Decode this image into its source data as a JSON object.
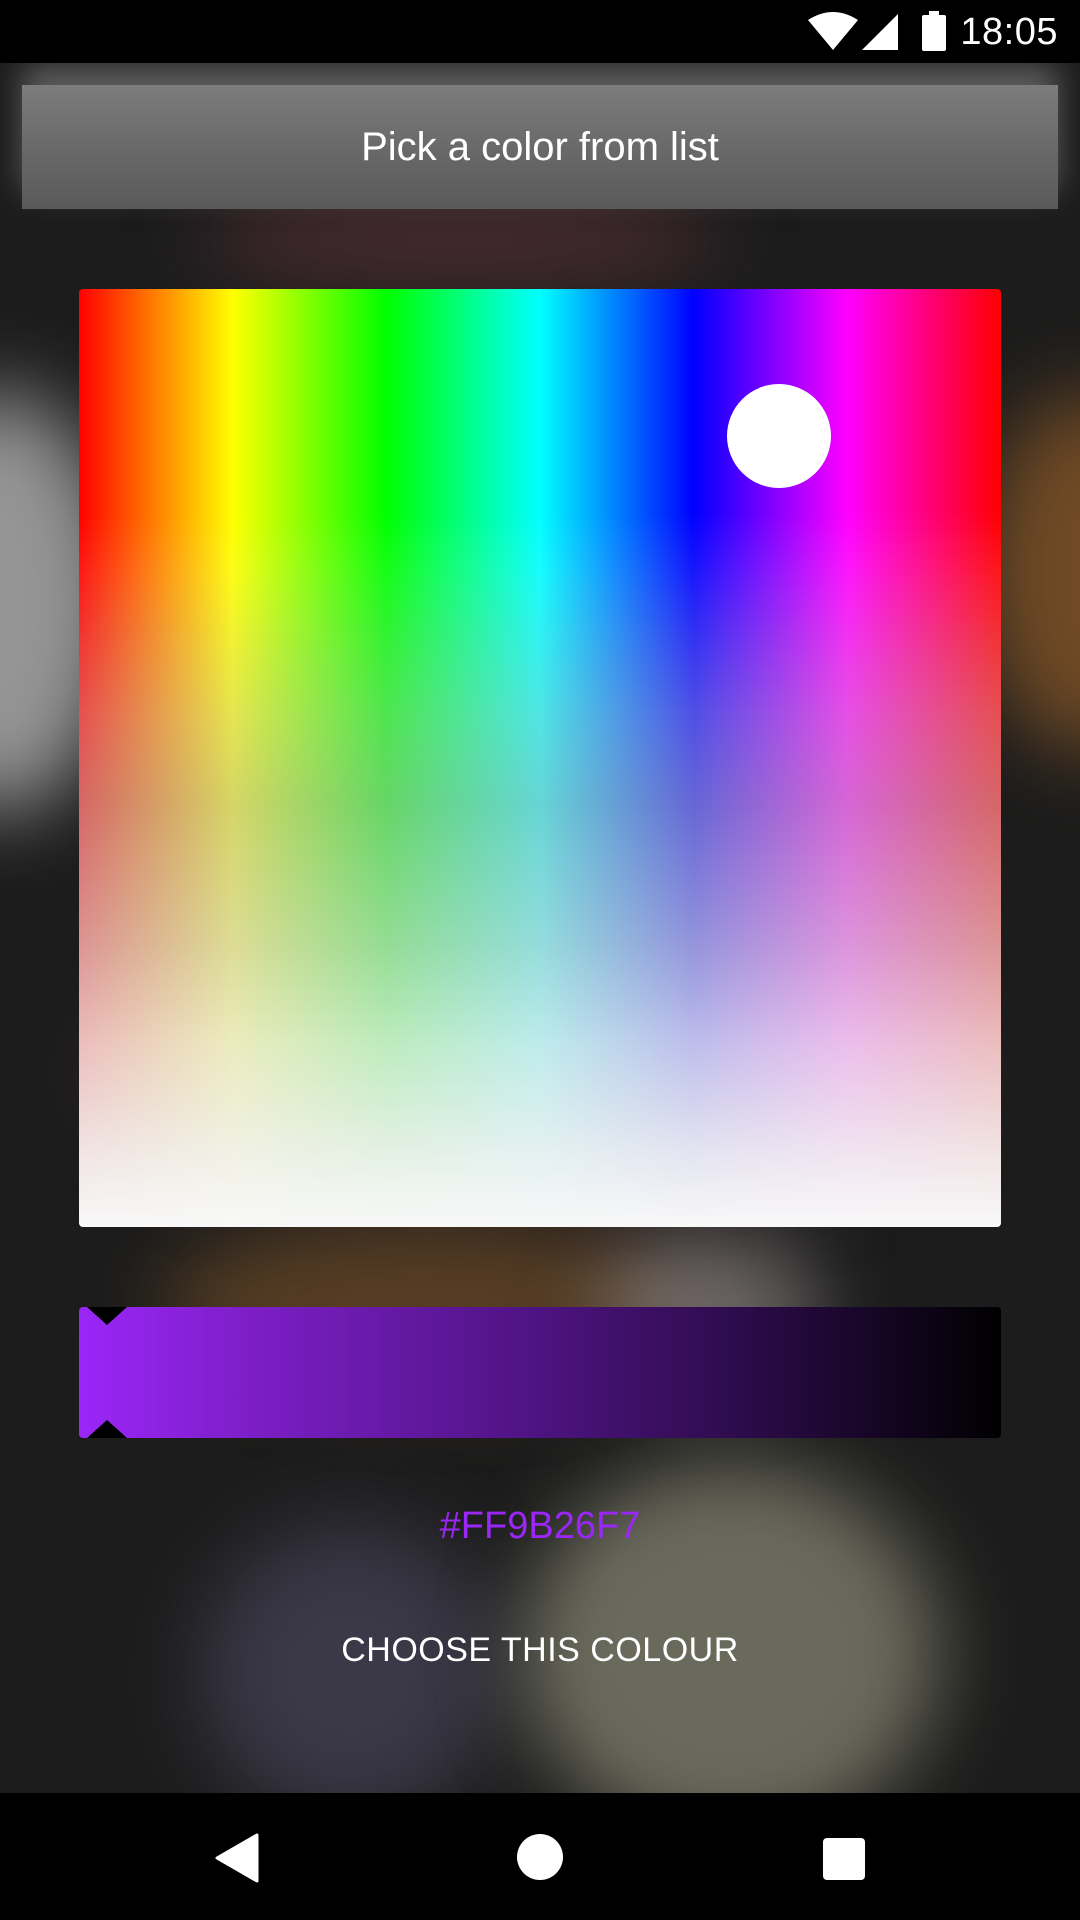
{
  "status_bar": {
    "time": "18:05",
    "icons": [
      "wifi-icon",
      "cell-signal-icon",
      "battery-icon"
    ]
  },
  "dialog": {
    "title": "Pick a color from list"
  },
  "picker": {
    "selected_hex": "#FF9B26F7",
    "brightness": 1.0,
    "colors": {
      "selected": "#9b26f7",
      "knob": "#ffffff"
    }
  },
  "actions": {
    "choose_label": "CHOOSE THIS COLOUR"
  },
  "nav_bar": {
    "buttons": [
      "back-icon",
      "home-icon",
      "recents-icon"
    ]
  }
}
